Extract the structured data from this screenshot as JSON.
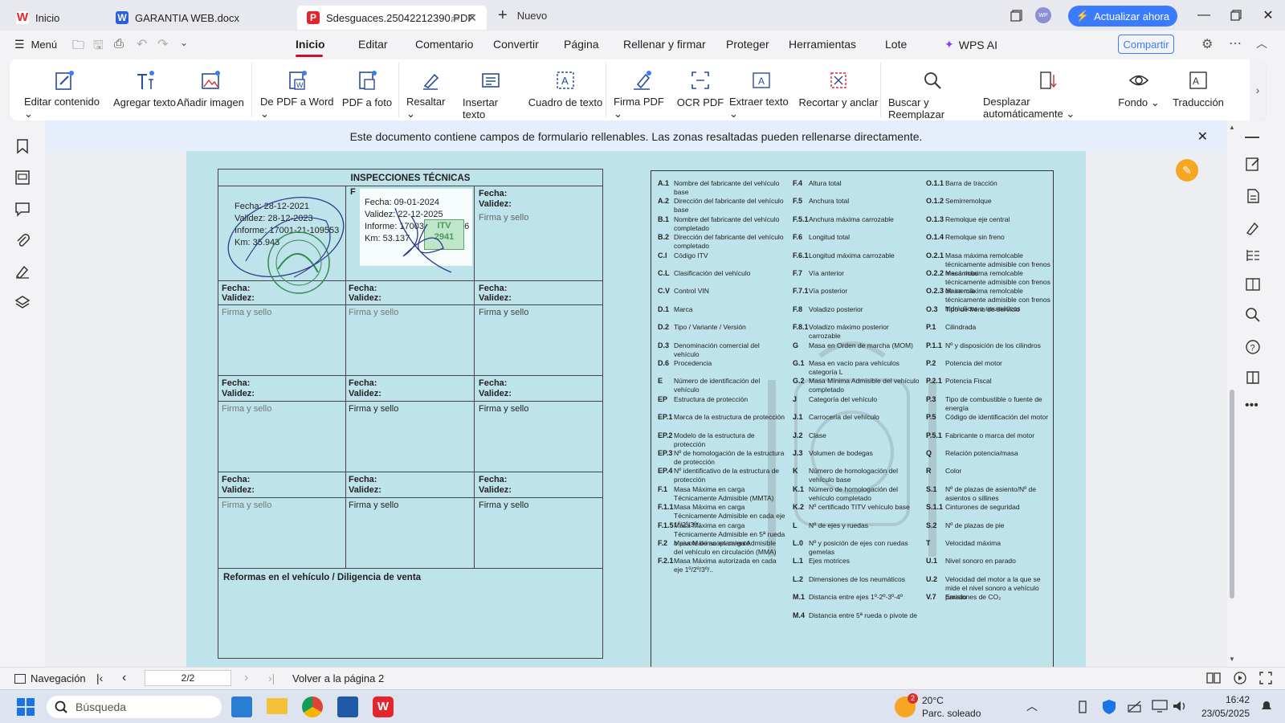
{
  "tabs": [
    {
      "label": "Inicio",
      "logo": "W",
      "logo_color": "#e2262b"
    },
    {
      "label": "GARANTIA WEB.docx",
      "logo": "W",
      "logo_color": "#2b5fd9"
    },
    {
      "label": "Sdesguaces.25042212390.PDF",
      "logo": "P",
      "logo_color": "#e2262b"
    }
  ],
  "new_tab": "Nuevo",
  "upgrade_button": "Actualizar ahora",
  "avatar": "WP",
  "menu_label": "Menú",
  "main_tabs": [
    "Inicio",
    "Editar",
    "Comentario",
    "Convertir",
    "Página",
    "Rellenar y firmar",
    "Proteger",
    "Herramientas",
    "Lote",
    "WPS AI"
  ],
  "share_button": "Compartir",
  "ribbon": [
    {
      "label": "Editar contenido",
      "icon": "edit-content-icon",
      "dropdown": true
    },
    {
      "label": "Agregar texto",
      "icon": "add-text-icon",
      "dropdown": false
    },
    {
      "label": "Añadir imagen",
      "icon": "add-image-icon",
      "dropdown": false
    },
    {
      "label": "De PDF a Word",
      "icon": "pdf-to-word-icon",
      "dropdown": true
    },
    {
      "label": "PDF a foto",
      "icon": "pdf-to-photo-icon",
      "dropdown": false
    },
    {
      "label": "Resaltar",
      "icon": "highlight-icon",
      "dropdown": true
    },
    {
      "label": "Insertar texto",
      "icon": "insert-text-icon",
      "dropdown": false
    },
    {
      "label": "Cuadro de texto",
      "icon": "text-box-icon",
      "dropdown": false
    },
    {
      "label": "Firma PDF",
      "icon": "signature-icon",
      "dropdown": true
    },
    {
      "label": "OCR PDF",
      "icon": "ocr-icon",
      "dropdown": false
    },
    {
      "label": "Extraer texto",
      "icon": "extract-text-icon",
      "dropdown": true
    },
    {
      "label": "Recortar y anclar",
      "icon": "crop-icon",
      "dropdown": false
    },
    {
      "label": "Buscar y Reemplazar",
      "icon": "search-replace-icon",
      "dropdown": false
    },
    {
      "label": "Desplazar automáticamente",
      "icon": "auto-scroll-icon",
      "dropdown": true
    },
    {
      "label": "Fondo",
      "icon": "eye-icon",
      "dropdown": true
    },
    {
      "label": "Traducción",
      "icon": "translate-icon",
      "dropdown": false
    }
  ],
  "notice": "Este documento contiene campos de formulario rellenables. Las zonas resaltadas pueden rellenarse directamente.",
  "document": {
    "left_title": "INSPECCIONES TÉCNICAS",
    "fecha_label": "Fecha:",
    "validez_label": "Validez:",
    "firma_label": "Firma y sello",
    "stamp1": {
      "fecha": "Fecha: 28-12-2021",
      "validez": "Validez: 28-12-2023",
      "informe": "Informe: 17001-21-109553",
      "km": "Km: 35.943"
    },
    "stamp2": {
      "fecha": "Fecha: 09-01-2024",
      "validez": "Validez: 22-12-2025",
      "informe": "Informe: 17003-24-000966",
      "km": "Km: 53.137"
    },
    "itv_badge": "ITV",
    "itv_number": "2941",
    "reformas": "Reformas en el vehículo / Diligencia de venta",
    "codes_col1": [
      [
        "A.1",
        "Nombre del fabricante del vehículo base"
      ],
      [
        "A.2",
        "Dirección del fabricante del vehículo base"
      ],
      [
        "B.1",
        "Nombre del fabricante del vehículo completado"
      ],
      [
        "B.2",
        "Dirección del fabricante del vehículo completado"
      ],
      [
        "C.I",
        "Código ITV"
      ],
      [
        "C.L",
        "Clasificación del vehículo"
      ],
      [
        "C.V",
        "Control VIN"
      ],
      [
        "D.1",
        "Marca"
      ],
      [
        "D.2",
        "Tipo / Variante / Versión"
      ],
      [
        "D.3",
        "Denominación comercial del vehículo"
      ],
      [
        "D.6",
        "Procedencia"
      ],
      [
        "E",
        "Número de identificación del vehículo"
      ],
      [
        "EP",
        "Estructura de protección"
      ],
      [
        "EP.1",
        "Marca de la estructura de protección"
      ],
      [
        "EP.2",
        "Modelo de la estructura de protección"
      ],
      [
        "EP.3",
        "Nº de homologación de la estructura de protección"
      ],
      [
        "EP.4",
        "Nº identificativo de la estructura de protección"
      ],
      [
        "F.1",
        "Masa Máxima en carga Técnicamente Admisible (MMTA)"
      ],
      [
        "F.1.1",
        "Masa Máxima en carga Técnicamente Admisible en cada eje 1º/2º/3º/.."
      ],
      [
        "F.1.5",
        "Masa Máxima en carga Técnicamente Admisible en 5ª rueda o pivote de acoplamiento"
      ],
      [
        "F.2",
        "Masa Máxima en carga Admisible del vehículo en circulación (MMA)"
      ],
      [
        "F.2.1",
        "Masa Máxima autorizada en cada eje 1º/2º/3º/.."
      ]
    ],
    "codes_col2": [
      [
        "F.4",
        "Altura total"
      ],
      [
        "F.5",
        "Anchura total"
      ],
      [
        "F.5.1",
        "Anchura máxima carrozable"
      ],
      [
        "F.6",
        "Longitud total"
      ],
      [
        "F.6.1",
        "Longitud máxima carrozable"
      ],
      [
        "F.7",
        "Vía anterior"
      ],
      [
        "F.7.1",
        "Vía posterior"
      ],
      [
        "F.8",
        "Voladizo posterior"
      ],
      [
        "F.8.1",
        "Voladizo máximo posterior carrozable"
      ],
      [
        "G",
        "Masa en Orden de marcha (MOM)"
      ],
      [
        "G.1",
        "Masa en vacío para vehículos categoría L"
      ],
      [
        "G.2",
        "Masa Mínima Admisible del vehículo completado"
      ],
      [
        "J",
        "Categoría del vehículo"
      ],
      [
        "J.1",
        "Carrocería del vehículo"
      ],
      [
        "J.2",
        "Clase"
      ],
      [
        "J.3",
        "Volumen de bodegas"
      ],
      [
        "K",
        "Número de homologación del vehículo base"
      ],
      [
        "K.1",
        "Número de homologación del vehículo completado"
      ],
      [
        "K.2",
        "Nº certificado TITV vehículo base"
      ],
      [
        "L",
        "Nº de ejes y ruedas"
      ],
      [
        "L.0",
        "Nº y posición de ejes con ruedas gemelas"
      ],
      [
        "L.1",
        "Ejes motrices"
      ],
      [
        "L.2",
        "Dimensiones de los neumáticos"
      ],
      [
        "M.1",
        "Distancia entre ejes 1º-2º-3º-4º"
      ],
      [
        "M.4",
        "Distancia entre 5ª rueda o pivote de"
      ]
    ],
    "codes_col3": [
      [
        "O.1.1",
        "Barra de tracción"
      ],
      [
        "O.1.2",
        "Semirremolque"
      ],
      [
        "O.1.3",
        "Remolque eje central"
      ],
      [
        "O.1.4",
        "Remolque sin freno"
      ],
      [
        "O.2.1",
        "Masa máxima remolcable técnicamente admisible con frenos mecánicos"
      ],
      [
        "O.2.2",
        "Masa máxima remolcable técnicamente admisible con frenos de inercia"
      ],
      [
        "O.2.3",
        "Masa máxima remolcable técnicamente admisible con frenos hidráulicos o neumáticos"
      ],
      [
        "O.3",
        "Tipo de freno de servicio"
      ],
      [
        "P.1",
        "Cilindrada"
      ],
      [
        "P.1.1",
        "Nº y disposición de los cilindros"
      ],
      [
        "P.2",
        "Potencia del motor"
      ],
      [
        "P.2.1",
        "Potencia Fiscal"
      ],
      [
        "P.3",
        "Tipo de combustible o fuente de energía"
      ],
      [
        "P.5",
        "Código de identificación del motor"
      ],
      [
        "P.5.1",
        "Fabricante o marca del motor"
      ],
      [
        "Q",
        "Relación potencia/masa"
      ],
      [
        "R",
        "Color"
      ],
      [
        "S.1",
        "Nº de plazas de asiento/Nº de asientos o sillines"
      ],
      [
        "S.1.1",
        "Cinturones de seguridad"
      ],
      [
        "S.2",
        "Nº de plazas de pie"
      ],
      [
        "T",
        "Velocidad máxima"
      ],
      [
        "U.1",
        "Nivel sonoro en parado"
      ],
      [
        "U.2",
        "Velocidad del motor a la que se mide el nivel sonoro a vehículo parado"
      ],
      [
        "V.7",
        "Emisiones de CO₂"
      ]
    ]
  },
  "status": {
    "navigation": "Navegación",
    "page_indicator": "2/2",
    "back_to_page": "Volver a la página 2"
  },
  "taskbar": {
    "search_placeholder": "Búsqueda",
    "weather_temp": "20°C",
    "weather_desc": "Parc. soleado",
    "weather_badge": "2",
    "time": "16:42",
    "date": "23/05/2025"
  },
  "colors": {
    "accent_red": "#c8102e",
    "upgrade_blue": "#3a7bff",
    "document_bg": "#bfe3ea"
  }
}
